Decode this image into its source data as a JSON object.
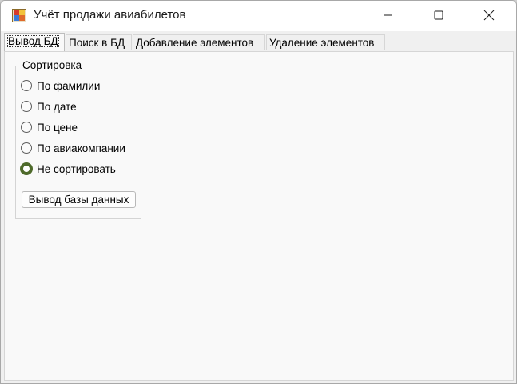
{
  "window": {
    "title": "Учёт продажи авиабилетов"
  },
  "tabs": [
    {
      "label": "Вывод БД",
      "active": true
    },
    {
      "label": "Поиск в БД",
      "active": false
    },
    {
      "label": "Добавление элементов",
      "active": false
    },
    {
      "label": "Удаление элементов",
      "active": false
    }
  ],
  "sort_group": {
    "title": "Сортировка",
    "options": [
      {
        "label": "По фамилии",
        "checked": false
      },
      {
        "label": "По дате",
        "checked": false
      },
      {
        "label": "По цене",
        "checked": false
      },
      {
        "label": "По авиакомпании",
        "checked": false
      },
      {
        "label": "Не сортировать",
        "checked": true
      }
    ],
    "button_label": "Вывод базы данных"
  },
  "colors": {
    "radio_checked": "#4e6a2a",
    "titlebar": "#ffffff",
    "page": "#f9f9f9"
  },
  "icons": {
    "app": "app-icon",
    "minimize": "minimize-icon",
    "maximize": "maximize-icon",
    "close": "close-icon"
  }
}
